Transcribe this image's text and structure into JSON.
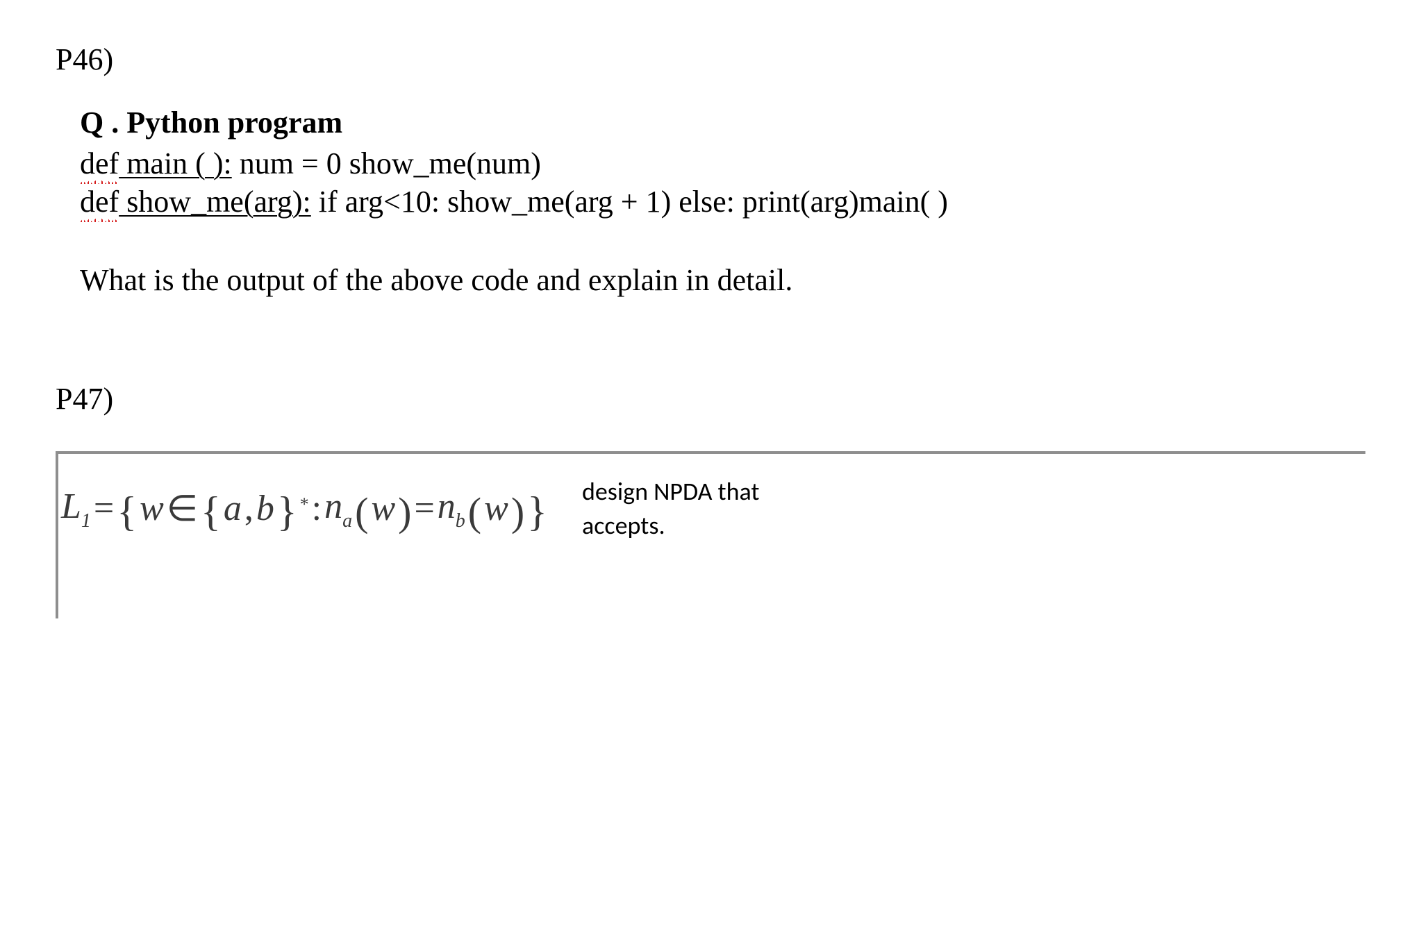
{
  "p46": {
    "label": "P46)",
    "q_label": "Q",
    "q_title": " . Python program",
    "code_line1_def": "def",
    "code_line1_rest_ul": " main ( ):",
    "code_line1_tail": " num = 0 show_me(num)",
    "code_line2_def": "def",
    "code_line2_rest_ul": " show_me(arg):",
    "code_line2_tail": "  if arg<10: show_me(arg + 1) else: print(arg)main( )",
    "prompt": "What is the output of the above code and explain in detail."
  },
  "p47": {
    "label": "P47)",
    "eq_L": "L",
    "eq_L_sub": "1",
    "eq_eq": " = ",
    "eq_w": "w",
    "eq_in": " ∈ ",
    "eq_a": "a",
    "eq_comma": ",",
    "eq_b": "b",
    "eq_star": "*",
    "eq_colon": " : ",
    "eq_n1": "n",
    "eq_n1_sub": "a",
    "eq_arg1": "w",
    "eq_mid": " = ",
    "eq_n2": "n",
    "eq_n2_sub": "b",
    "eq_arg2": "w",
    "npda_line1": "design NPDA that",
    "npda_line2": "accepts."
  }
}
